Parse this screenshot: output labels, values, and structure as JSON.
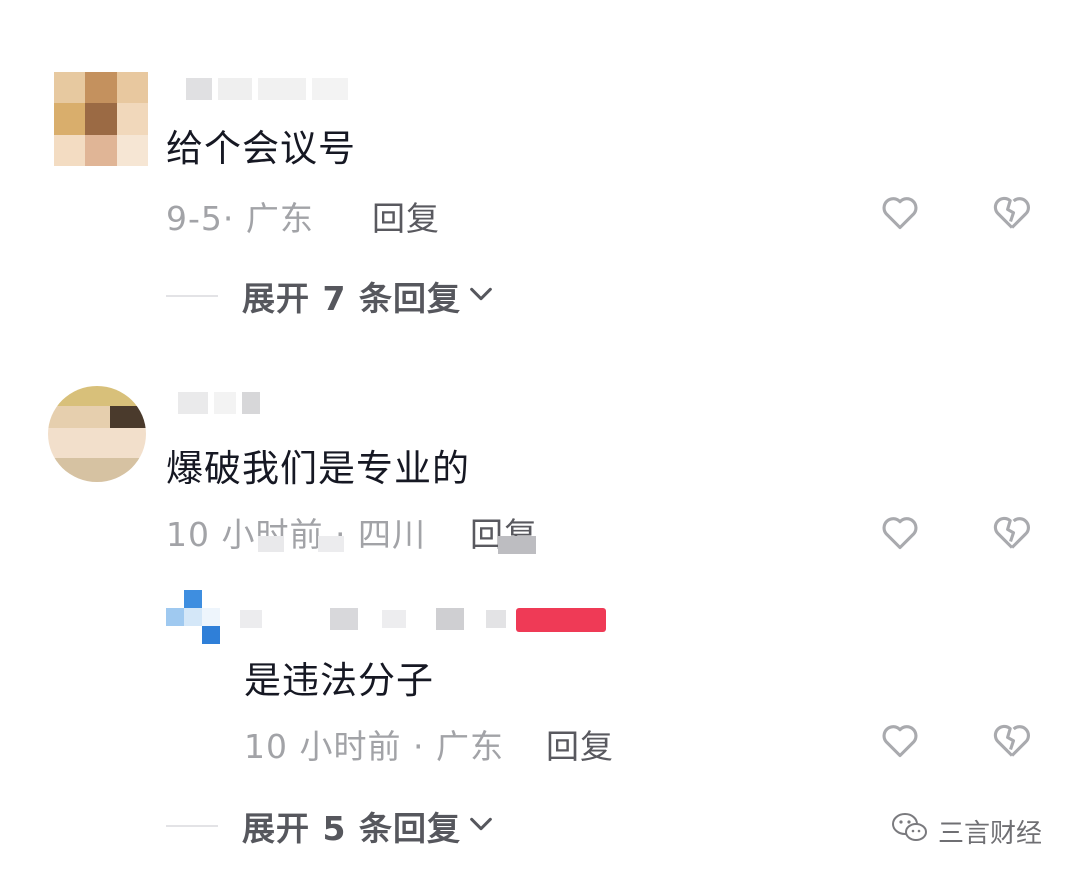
{
  "comments": [
    {
      "text": "给个会议号",
      "meta": "9-5· 广东",
      "reply_label": "回复",
      "expand_label": "展开 7 条回复"
    },
    {
      "text": "爆破我们是专业的",
      "meta": "10 小时前 · 四川",
      "reply_label": "回复",
      "reply_comment": {
        "text": "是违法分子",
        "meta": "10 小时前 · 广东",
        "reply_label": "回复"
      },
      "expand_label": "展开 5 条回复"
    }
  ],
  "icons": {
    "like": "heart-outline-icon",
    "dislike": "broken-heart-icon",
    "expand": "chevron-down-icon"
  },
  "watermark": {
    "text": "三言财经"
  },
  "colors": {
    "text": "#161823",
    "meta": "#a2a3a7",
    "reply": "#59595f",
    "icon": "#a9aaae",
    "author_tag": "#ee3e5a"
  }
}
